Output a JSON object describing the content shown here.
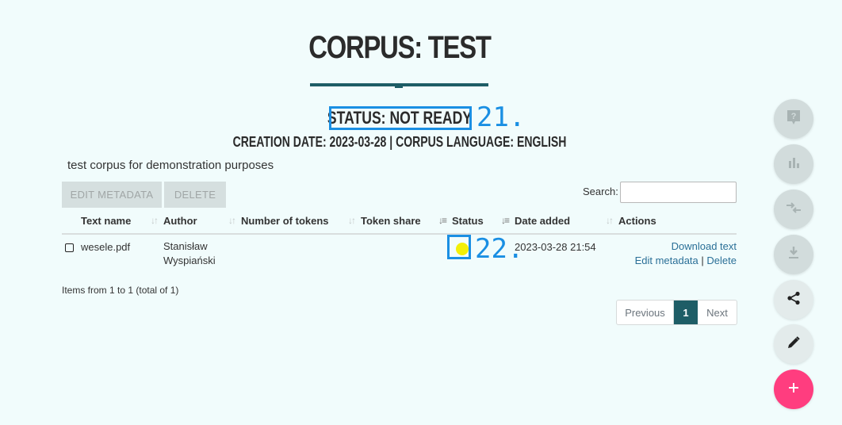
{
  "page": {
    "title": "CORPUS: TEST",
    "status": "STATUS: NOT READY",
    "meta": "CREATION DATE: 2023-03-28 | CORPUS LANGUAGE: ENGLISH",
    "description": "test corpus for demonstration purposes"
  },
  "annotations": {
    "a21": "21.",
    "a22": "22."
  },
  "toolbar": {
    "edit_metadata": "EDIT METADATA",
    "delete": "DELETE",
    "search_label": "Search:",
    "search_value": ""
  },
  "table": {
    "headers": [
      "Text name",
      "Author",
      "Number of tokens",
      "Token share",
      "Status",
      "Date added",
      "Actions"
    ],
    "rows": [
      {
        "name": "wesele.pdf",
        "author_line1": "Stanisław",
        "author_line2": "Wyspiański",
        "tokens": "",
        "share": "",
        "status_color": "#f2ef07",
        "date": "2023-03-28 21:54",
        "action_download": "Download text",
        "action_edit": "Edit metadata",
        "action_sep": "|",
        "action_delete": "Delete"
      }
    ]
  },
  "pagination": {
    "info": "Items from 1 to 1 (total of 1)",
    "previous": "Previous",
    "current": "1",
    "next": "Next"
  },
  "fab_buttons": [
    {
      "icon": "help-icon",
      "label": "?"
    },
    {
      "icon": "bar-chart-icon"
    },
    {
      "icon": "compare-arrows-icon"
    },
    {
      "icon": "download-icon"
    },
    {
      "icon": "share-icon"
    },
    {
      "icon": "edit-icon"
    },
    {
      "icon": "add-icon",
      "label": "+"
    }
  ],
  "colors": {
    "accent": "#1e5d66",
    "annotation": "#1a8fe3",
    "add_button": "#ff3d7f",
    "background": "#f1fcfc"
  }
}
